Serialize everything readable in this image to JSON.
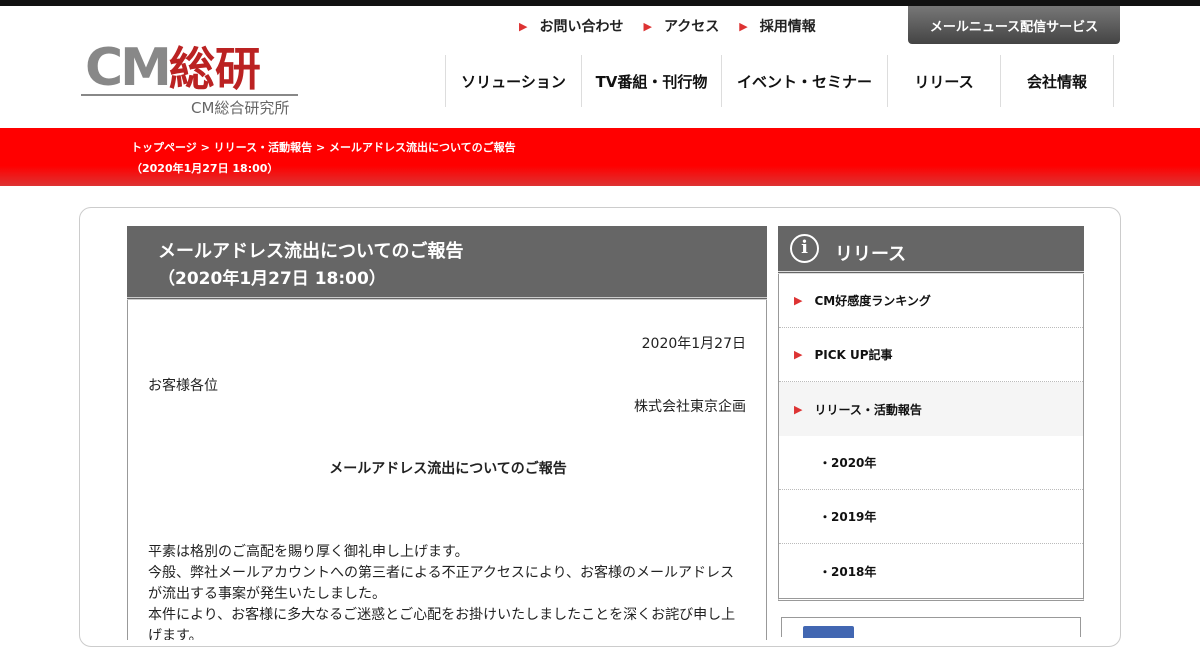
{
  "header": {
    "logo_main": "CM",
    "logo_kanji": "総研",
    "logo_sub": "CM総合研究所",
    "util_links": [
      {
        "label": "お問い合わせ"
      },
      {
        "label": "アクセス"
      },
      {
        "label": "採用情報"
      }
    ],
    "mailnews_label": "メールニュース配信サービス",
    "nav": [
      {
        "label": "ソリューション"
      },
      {
        "label": "TV番組・刊行物"
      },
      {
        "label": "イベント・セミナー"
      },
      {
        "label": "リリース"
      },
      {
        "label": "会社情報"
      }
    ]
  },
  "breadcrumb": {
    "home": "トップページ",
    "sep": " > ",
    "section": "リリース・活動報告",
    "current": "メールアドレス流出についてのご報告",
    "current_date": "（2020年1月27日 18:00）"
  },
  "article": {
    "title": "メールアドレス流出についてのご報告",
    "title_date": "（2020年1月27日 18:00）",
    "date": "2020年1月27日",
    "greeting": "お客様各位",
    "company": "株式会社東京企画",
    "body_title": "メールアドレス流出についてのご報告",
    "paragraph_1": "平素は格別のご高配を賜り厚く御礼申し上げます。",
    "paragraph_2": "今般、弊社メールアカウントへの第三者による不正アクセスにより、お客様のメールアドレスが流出する事案が発生いたしました。",
    "paragraph_3": "本件により、お客様に多大なるご迷惑とご心配をお掛けいたしましたことを深くお詫び申し上げます。"
  },
  "sidebar": {
    "title": "リリース",
    "items": [
      {
        "label": "CM好感度ランキング"
      },
      {
        "label": "PICK UP記事"
      },
      {
        "label": "リリース・活動報告"
      }
    ],
    "sub_items": [
      {
        "label": "・2020年"
      },
      {
        "label": "・2019年"
      },
      {
        "label": "・2018年"
      }
    ]
  },
  "colors": {
    "accent_red": "#ff0000",
    "panel_gray": "#666666",
    "marker_red": "#dd3333"
  }
}
